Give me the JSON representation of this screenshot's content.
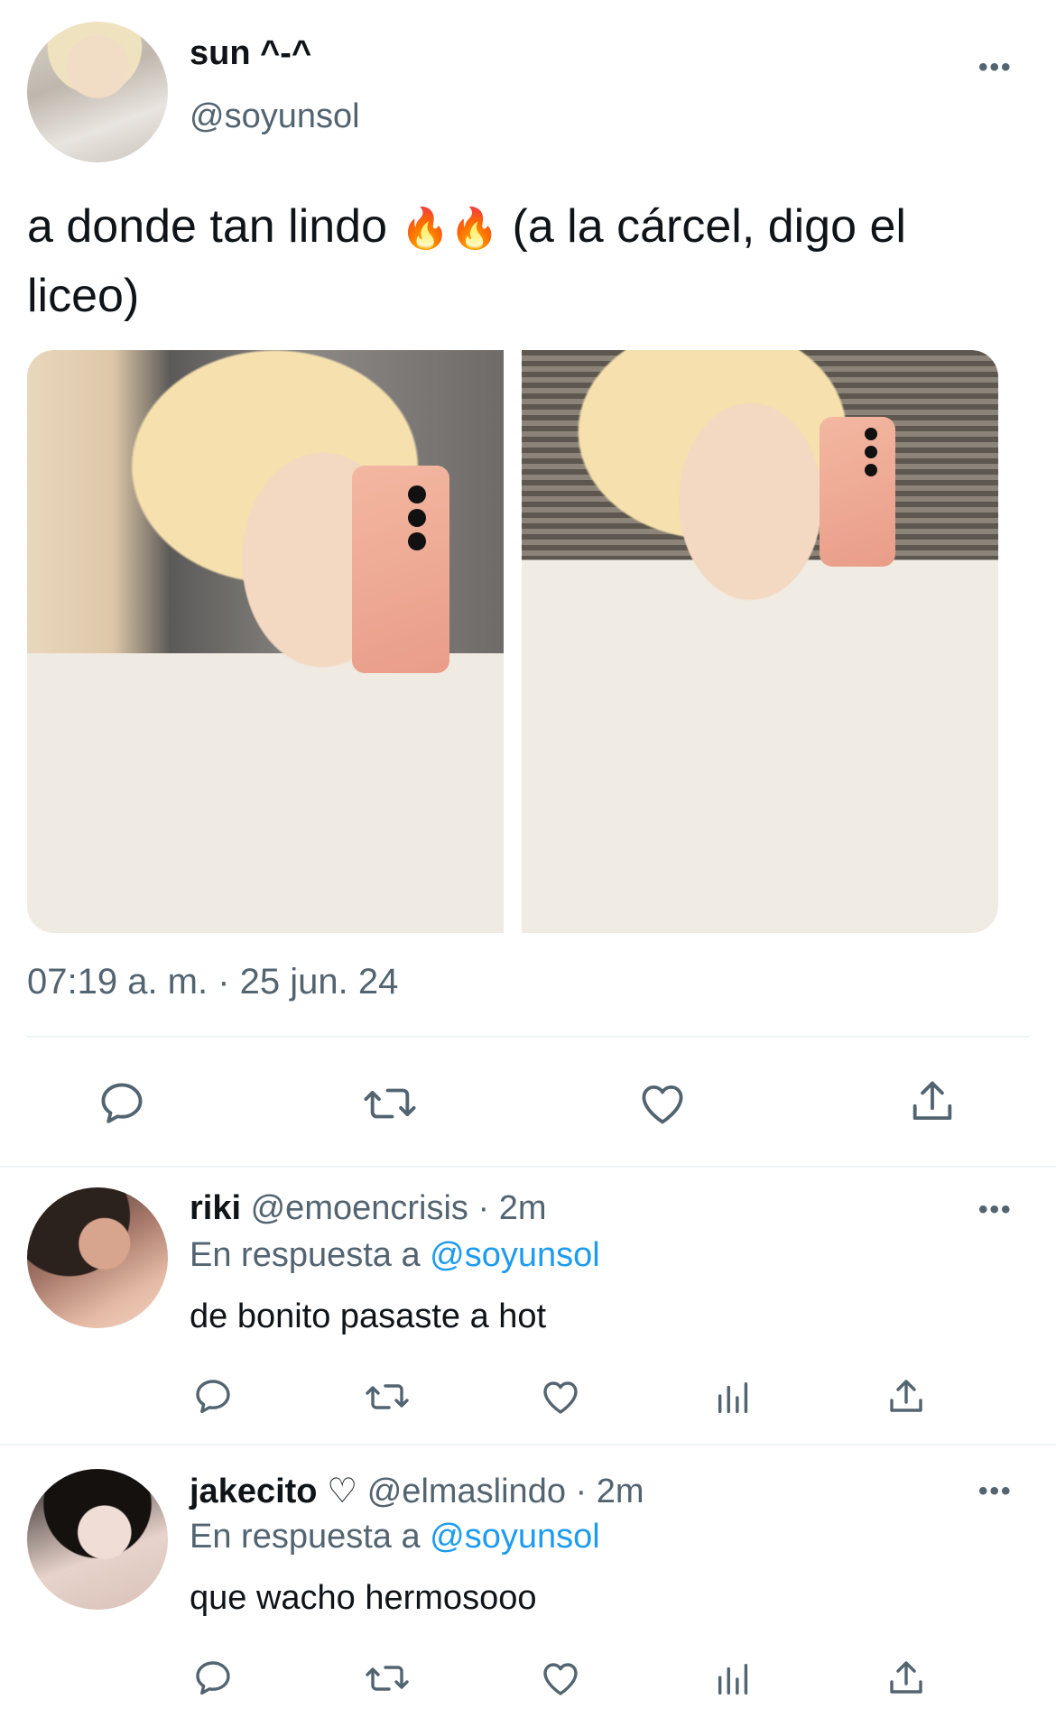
{
  "main_tweet": {
    "display_name": "sun ^-^",
    "handle": "@soyunsol",
    "text_before": "a donde tan lindo",
    "emoji": "🔥🔥",
    "text_after": "(a la cárcel, digo el liceo)",
    "timestamp": "07:19 a. m. · 25 jun. 24",
    "more_label": "•••"
  },
  "replies": [
    {
      "display_name": "riki",
      "handle": "@emoencrisis",
      "time": "· 2m",
      "reply_prefix": "En respuesta a",
      "reply_to": "@soyunsol",
      "text": "de bonito pasaste a hot",
      "more_label": "•••"
    },
    {
      "display_name": "jakecito",
      "name_badge": "♡",
      "handle": "@elmaslindo",
      "time": "· 2m",
      "reply_prefix": "En respuesta a",
      "reply_to": "@soyunsol",
      "text": "que wacho hermosooo",
      "more_label": "•••"
    }
  ],
  "icons": {
    "reply": "reply-icon",
    "retweet": "retweet-icon",
    "like": "heart-icon",
    "views": "views-icon",
    "share": "share-icon"
  },
  "colors": {
    "text": "#0f1419",
    "secondary": "#536471",
    "link": "#1d9bf0",
    "divider": "#eff3f4"
  }
}
